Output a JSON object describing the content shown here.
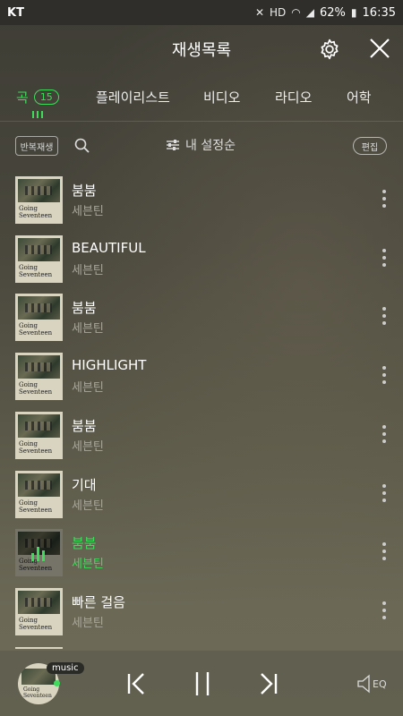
{
  "status_bar": {
    "carrier": "KT",
    "battery": "62%",
    "time": "16:35"
  },
  "header": {
    "title": "재생목록"
  },
  "tabs": [
    {
      "label": "곡",
      "badge": "15",
      "active": true
    },
    {
      "label": "플레이리스트"
    },
    {
      "label": "비디오"
    },
    {
      "label": "라디오"
    },
    {
      "label": "어학"
    }
  ],
  "toolbar": {
    "repeat_label": "반복재생",
    "sort_label": "내 설정순",
    "edit_label": "편집"
  },
  "album_caption": [
    "Going",
    "Seventeen"
  ],
  "songs": [
    {
      "title": "붐붐",
      "artist": "세븐틴"
    },
    {
      "title": "BEAUTIFUL",
      "artist": "세븐틴"
    },
    {
      "title": "붐붐",
      "artist": "세븐틴"
    },
    {
      "title": "HIGHLIGHT",
      "artist": "세븐틴"
    },
    {
      "title": "붐붐",
      "artist": "세븐틴"
    },
    {
      "title": "기대",
      "artist": "세븐틴"
    },
    {
      "title": "붐붐",
      "artist": "세븐틴",
      "playing": true
    },
    {
      "title": "빠른 걸음",
      "artist": "세븐틴"
    }
  ],
  "player": {
    "badge": "music",
    "eq_label": "EQ"
  },
  "colors": {
    "accent": "#3fdc5c"
  }
}
